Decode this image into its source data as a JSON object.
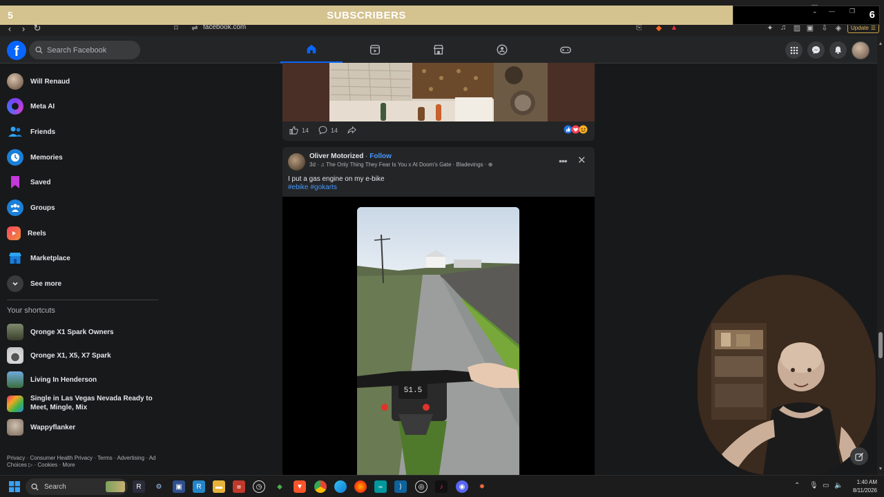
{
  "overlay": {
    "title": "SUBSCRIBERS",
    "left_number": "5",
    "right_number": "6"
  },
  "browser": {
    "url": "facebook.com",
    "update_label": "Update"
  },
  "header": {
    "logo": "f",
    "search_placeholder": "Search Facebook",
    "nav_tabs": [
      "home-icon",
      "video-icon",
      "marketplace-icon",
      "groups-icon",
      "gaming-icon"
    ]
  },
  "sidebar": {
    "items": [
      {
        "label": "Will Renaud",
        "icon": "avatar"
      },
      {
        "label": "Meta AI",
        "icon": "meta-ai-icon"
      },
      {
        "label": "Friends",
        "icon": "friends-icon"
      },
      {
        "label": "Memories",
        "icon": "memories-icon"
      },
      {
        "label": "Saved",
        "icon": "saved-icon"
      },
      {
        "label": "Groups",
        "icon": "groups-icon"
      },
      {
        "label": "Reels",
        "icon": "reels-icon"
      },
      {
        "label": "Marketplace",
        "icon": "marketplace-icon"
      },
      {
        "label": "See more",
        "icon": "chevron-down-icon"
      }
    ],
    "shortcuts_title": "Your shortcuts",
    "shortcuts": [
      {
        "label": "Qronge X1 Spark Owners"
      },
      {
        "label": "Qronge X1, X5, X7 Spark"
      },
      {
        "label": "Living In Henderson"
      },
      {
        "label": "Single in Las Vegas Nevada Ready to Meet, Mingle, Mix"
      },
      {
        "label": "Wappyflanker"
      }
    ],
    "footer": "Privacy · Consumer Health Privacy · Terms · Advertising · Ad Choices ▷ · Cookies · More"
  },
  "post1": {
    "likes": "14",
    "comments": "14"
  },
  "post2": {
    "author": "Oliver Motorized",
    "follow": "Follow",
    "meta": "3d · ♫ The Only Thing They Fear Is You x At Doom's Gate · Bladevings · ",
    "text": "I put a gas engine on my e-bike",
    "hashtags": [
      "#ebike",
      "#gokarts"
    ],
    "speed_readout": "51.5"
  },
  "taskbar": {
    "search_label": "Search",
    "time": "1:40 AM",
    "date": "8/11/2026"
  },
  "colors": {
    "accent": "#0866ff",
    "link": "#4599ff",
    "overlay": "#d4c28f"
  }
}
